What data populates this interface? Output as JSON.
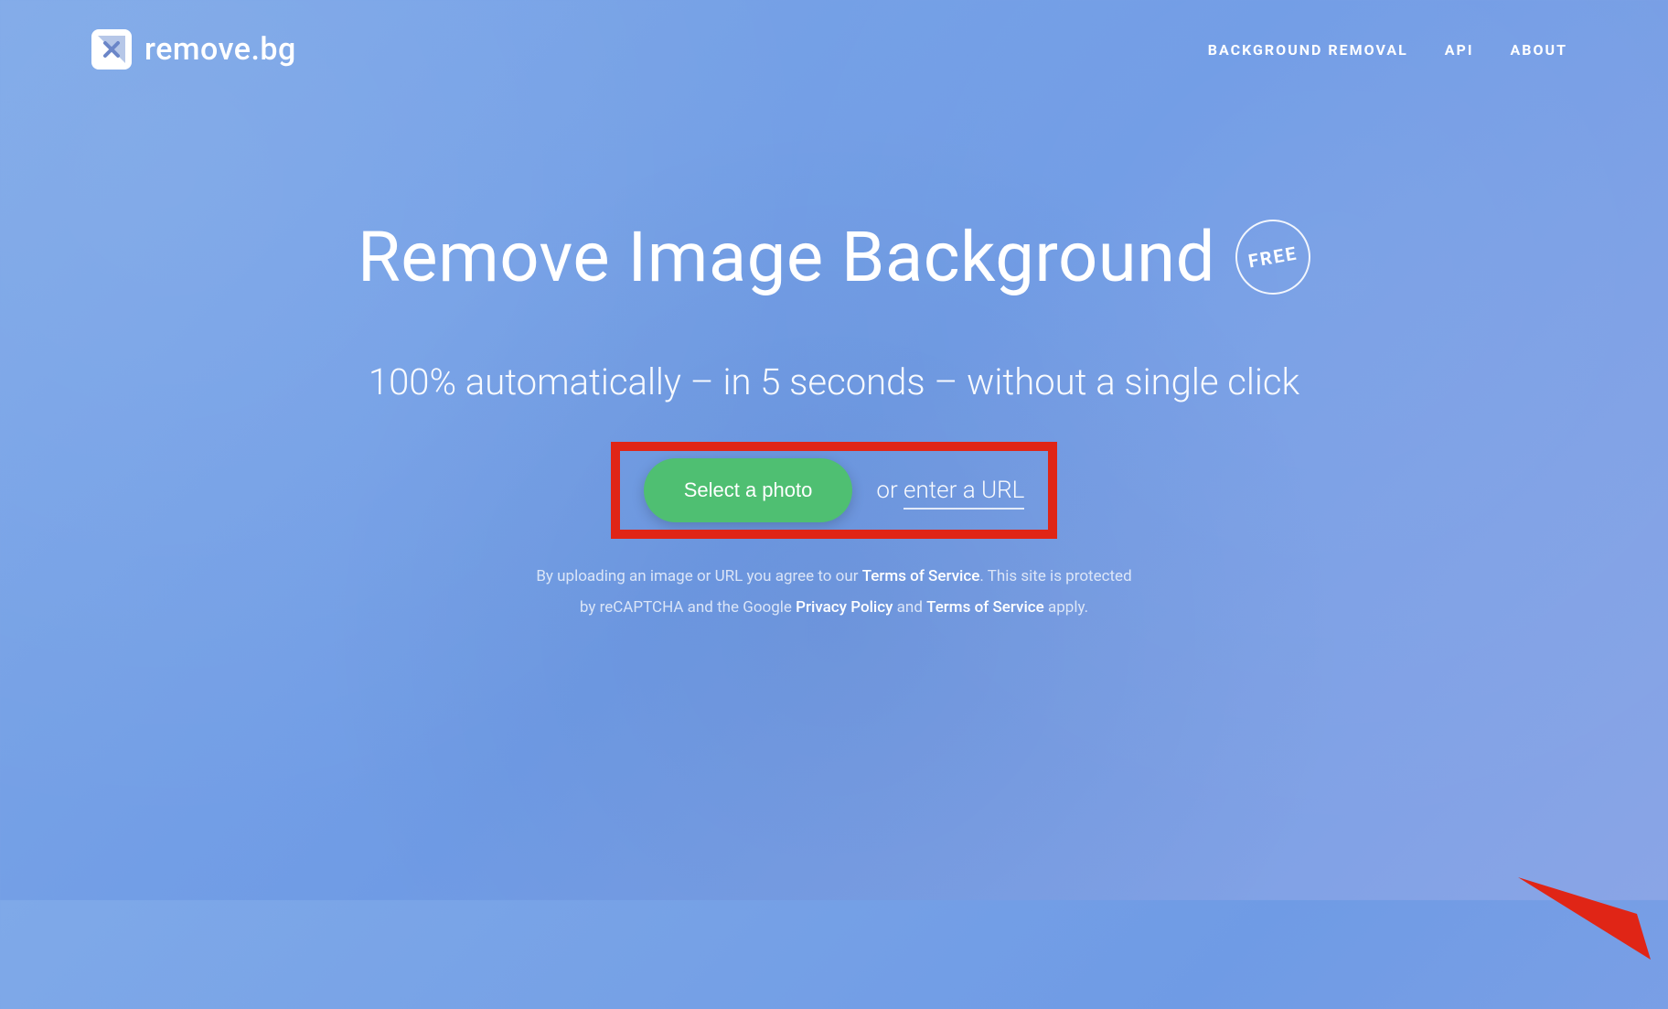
{
  "brand": {
    "name": "remove.bg",
    "icon": "x-clip-icon"
  },
  "nav": {
    "items": [
      {
        "label": "BACKGROUND REMOVAL"
      },
      {
        "label": "API"
      },
      {
        "label": "ABOUT"
      }
    ]
  },
  "hero": {
    "headline": "Remove Image Background",
    "badge": "FREE",
    "subheadline": "100% automatically – in 5 seconds – without a single click"
  },
  "upload": {
    "button_label": "Select a photo",
    "or_prefix": "or ",
    "url_link": "enter a URL"
  },
  "annotation": {
    "highlight": "upload-area",
    "arrow_icon": "arrow-icon",
    "arrow_color": "#e02516"
  },
  "disclaimer": {
    "line1_pre": "By uploading an image or URL you agree to our ",
    "tos1": "Terms of Service",
    "line1_post": ". This site is protected",
    "line2_pre": "by reCAPTCHA and the Google ",
    "pp": "Privacy Policy",
    "and": " and ",
    "tos2": "Terms of Service",
    "apply": " apply."
  },
  "colors": {
    "accent_green": "#4fbf72",
    "highlight_red": "#e02516",
    "bg_gradient_start": "#7fa9e8",
    "bg_gradient_end": "#8aa5e6"
  }
}
